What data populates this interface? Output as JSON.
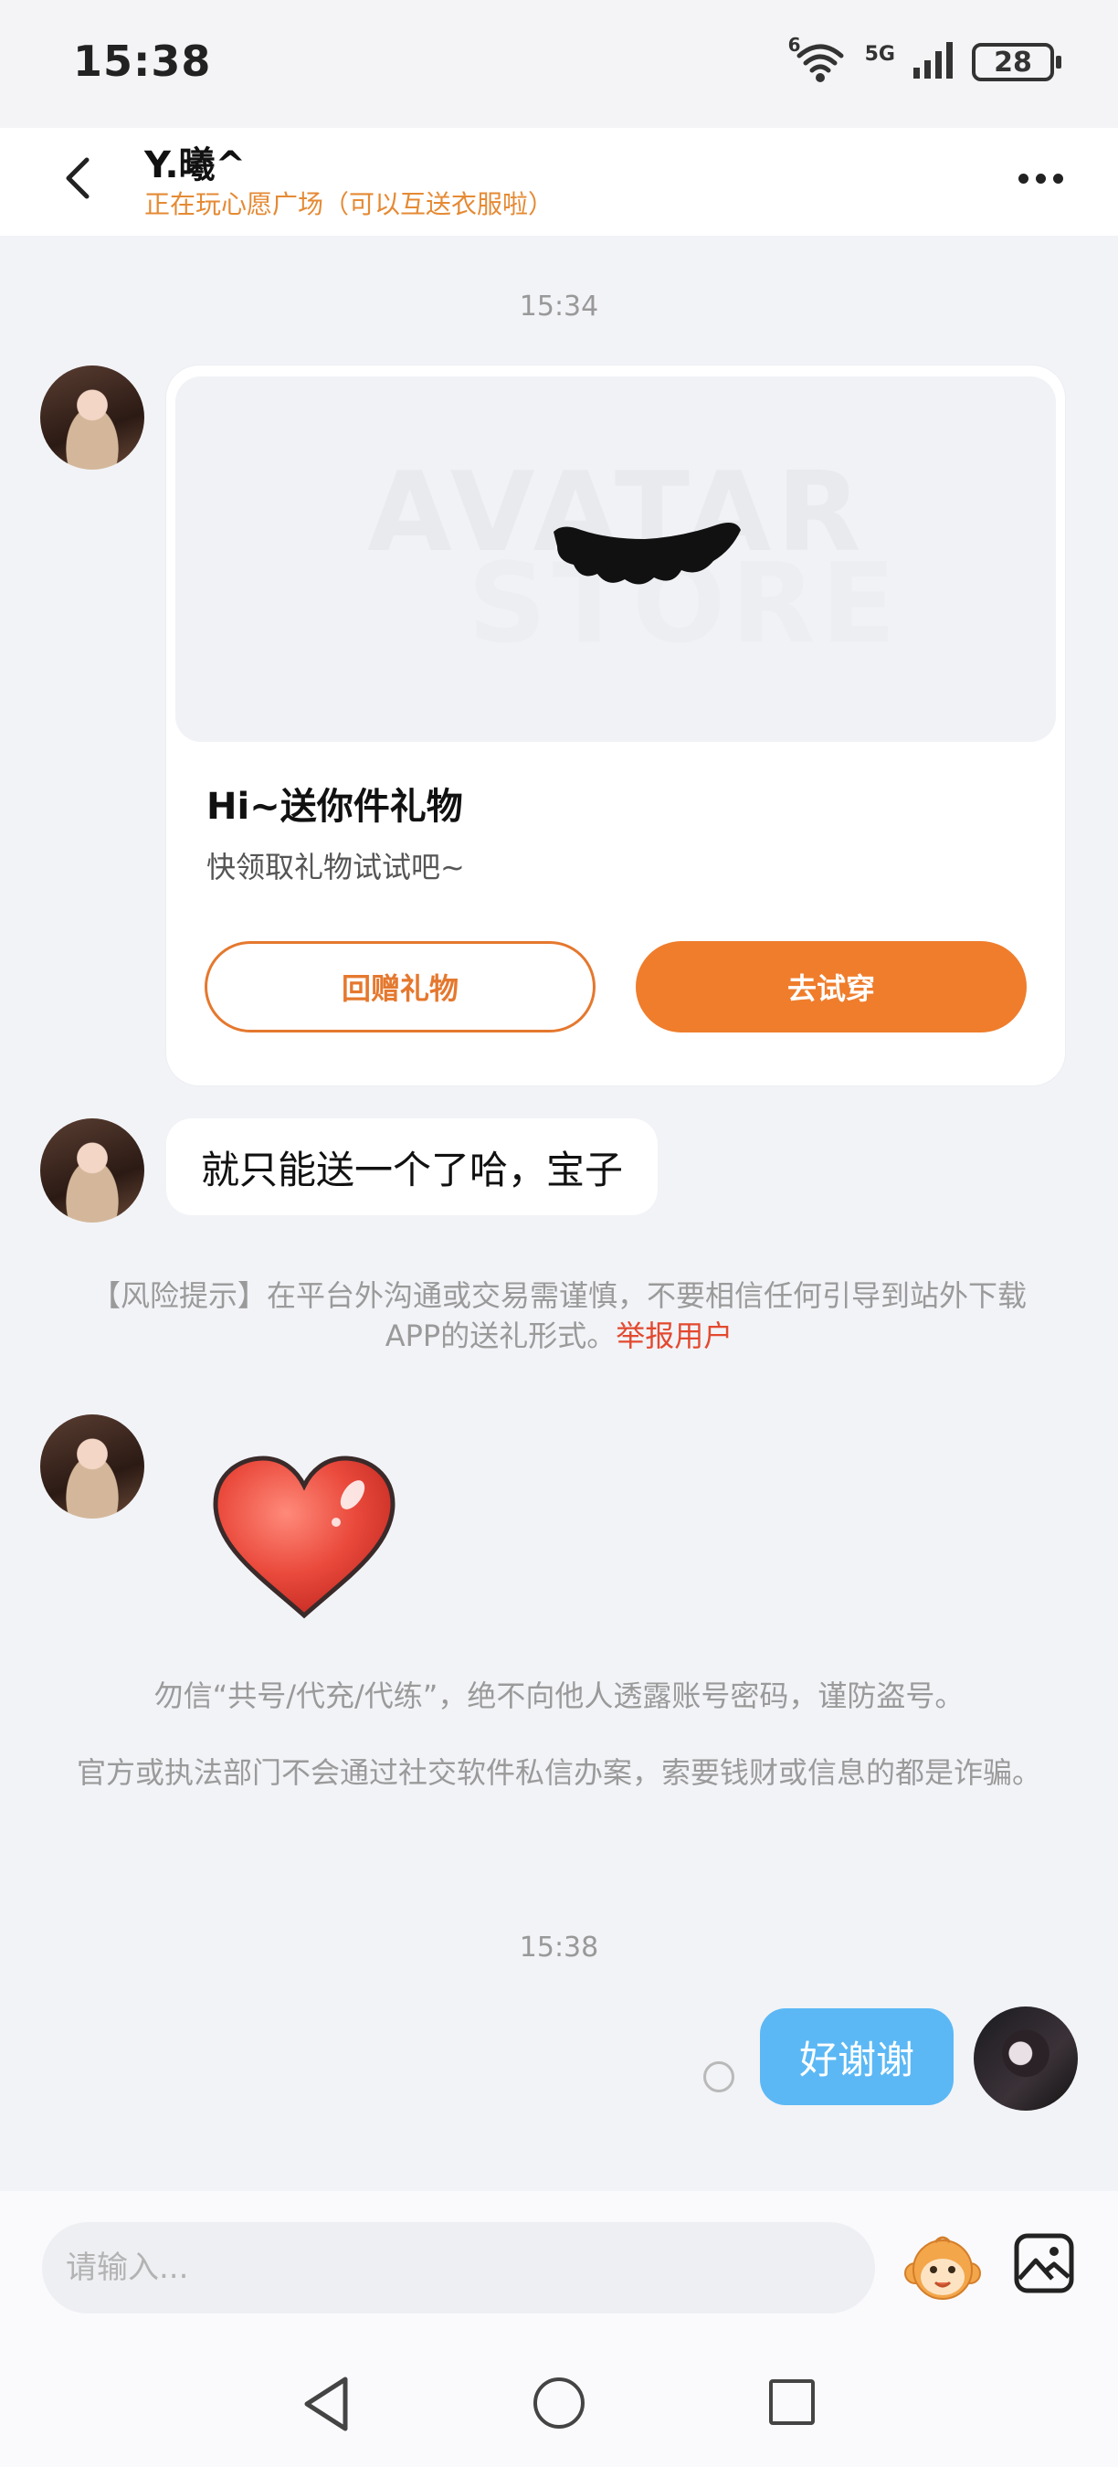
{
  "status_bar": {
    "time": "15:38",
    "wifi_label": "6",
    "network": "5G",
    "battery": "28",
    "icons": [
      "wifi-icon",
      "signal-icon",
      "battery-icon"
    ]
  },
  "header": {
    "name": "Y.曦^",
    "status": "正在玩心愿广场（可以互送衣服啦）",
    "back_icon": "chevron-left-icon",
    "more_icon": "more-icon"
  },
  "chat": {
    "timestamps": [
      "15:34",
      "15:38"
    ],
    "gift_card": {
      "watermark_line1": "AVATAR",
      "watermark_line2": "STORE",
      "title": "Hi~送你件礼物",
      "subtitle": "快领取礼物试试吧~",
      "return_button": "回赠礼物",
      "try_button": "去试穿"
    },
    "message_1": "就只能送一个了哈，宝子",
    "risk_notice": {
      "text": "【风险提示】在平台外沟通或交易需谨慎，不要相信任何引导到站外下载APP的送礼形式。",
      "link": "举报用户"
    },
    "sticker": "heart-sticker",
    "notice_1": "勿信“共号/代充/代练”，绝不向他人透露账号密码，谨防盗号。",
    "notice_2": "官方或执法部门不会通过社交软件私信办案，索要钱财或信息的都是诈骗。",
    "my_message": "好谢谢"
  },
  "input_bar": {
    "placeholder": "请输入...",
    "emoji_icon": "monkey-emoji-icon",
    "image_icon": "image-icon"
  },
  "nav_bar": {
    "icons": [
      "nav-back-icon",
      "nav-home-icon",
      "nav-recent-icon"
    ]
  },
  "colors": {
    "accent_orange": "#ef7d2c",
    "status_orange": "#e58a34",
    "my_bubble": "#5bb8f5",
    "report_red": "#e3492f"
  }
}
